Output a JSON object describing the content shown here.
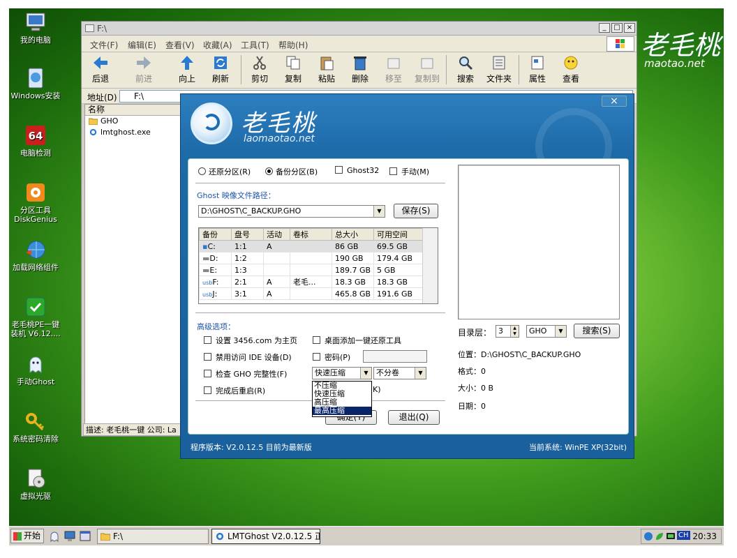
{
  "desktop": {
    "brand": {
      "name": "老毛桃",
      "url": "maotao.net"
    },
    "icons": [
      {
        "label": "我的电脑",
        "icon": "computer-icon"
      },
      {
        "label": "Windows安装",
        "icon": "windows-install-icon"
      },
      {
        "label": "电脑检测",
        "icon": "cpu-64-icon"
      },
      {
        "label": "分区工具\nDiskGenius",
        "icon": "diskgenius-icon"
      },
      {
        "label": "加载网络组件",
        "icon": "network-globe-icon"
      },
      {
        "label": "老毛桃PE一键\n装机 V6.12....",
        "icon": "laomaotao-installer-icon"
      },
      {
        "label": "手动Ghost",
        "icon": "ghost-icon"
      },
      {
        "label": "系统密码清除",
        "icon": "key-icon"
      },
      {
        "label": "虚拟光驱",
        "icon": "virtual-cdrom-icon"
      }
    ]
  },
  "explorer": {
    "title": "F:\\",
    "menu": [
      "文件(F)",
      "编辑(E)",
      "查看(V)",
      "收藏(A)",
      "工具(T)",
      "帮助(H)"
    ],
    "toolbar": [
      {
        "label": "后退",
        "icon": "back-arrow-icon",
        "enabled": true
      },
      {
        "label": "前进",
        "icon": "forward-arrow-icon",
        "enabled": false
      },
      {
        "label": "向上",
        "icon": "up-arrow-icon",
        "enabled": true
      },
      {
        "label": "刷新",
        "icon": "refresh-icon",
        "enabled": true
      },
      {
        "label": "剪切",
        "icon": "scissors-icon",
        "enabled": true
      },
      {
        "label": "复制",
        "icon": "copy-icon",
        "enabled": true
      },
      {
        "label": "粘贴",
        "icon": "paste-icon",
        "enabled": true
      },
      {
        "label": "删除",
        "icon": "delete-icon",
        "enabled": true
      },
      {
        "label": "移至",
        "icon": "move-to-icon",
        "enabled": false
      },
      {
        "label": "复制到",
        "icon": "copy-to-icon",
        "enabled": false
      },
      {
        "label": "搜索",
        "icon": "search-icon",
        "enabled": true
      },
      {
        "label": "文件夹",
        "icon": "folder-tree-icon",
        "enabled": true
      },
      {
        "label": "属性",
        "icon": "properties-icon",
        "enabled": true
      },
      {
        "label": "查看",
        "icon": "view-icon",
        "enabled": true
      }
    ],
    "address_label": "地址(D)",
    "address_value": "F:\\",
    "column_header": "名称",
    "files": [
      {
        "name": "GHO",
        "icon": "folder-icon"
      },
      {
        "name": "lmtghost.exe",
        "icon": "ghost-exe-icon"
      }
    ],
    "status": "描述: 老毛桃一键 公司: La"
  },
  "dialog": {
    "brand_name": "老毛桃",
    "brand_url": "laomaotao.net",
    "close": "×",
    "modes": [
      {
        "label": "还原分区(R)",
        "type": "radio",
        "checked": false
      },
      {
        "label": "备份分区(B)",
        "type": "radio",
        "checked": true
      },
      {
        "label": "Ghost32",
        "type": "checkbox",
        "checked": false
      },
      {
        "label": "手动(M)",
        "type": "checkbox",
        "checked": false
      }
    ],
    "path_label": "Ghost 映像文件路径：",
    "path_value": "D:\\GHOST\\C_BACKUP.GHO",
    "save_label": "保存(S)",
    "table": {
      "headers": [
        "备份",
        "盘号",
        "活动",
        "卷标",
        "总大小",
        "可用空间"
      ],
      "rows": [
        [
          "C:",
          "1:1",
          "A",
          "",
          "86 GB",
          "69.5 GB"
        ],
        [
          "D:",
          "1:2",
          "",
          "",
          "190 GB",
          "179.4 GB"
        ],
        [
          "E:",
          "1:3",
          "",
          "",
          "189.7 GB",
          "5 GB"
        ],
        [
          "F:",
          "2:1",
          "A",
          "老毛...",
          "18.3 GB",
          "18.3 GB"
        ],
        [
          "J:",
          "3:1",
          "A",
          "",
          "465.8 GB",
          "191.6 GB"
        ]
      ]
    },
    "advanced_label": "高级选项：",
    "options": {
      "homepage": "设置 3456.com 为主页",
      "desktop_restore": "桌面添加一键还原工具",
      "disable_ide": "禁用访问 IDE 设备(D)",
      "password": "密码(P)",
      "check_gho": "检查 GHO 完整性(F)",
      "reboot": "完成后重启(R)"
    },
    "compression_selected": "快速压缩",
    "compression_options": [
      "不压缩",
      "快速压缩",
      "高压缩",
      "最高压缩"
    ],
    "compression_highlighted": "最高压缩",
    "split_selected": "不分卷",
    "partial_letter": "K)",
    "ok_label": "确定(Y)",
    "exit_label": "退出(Q)",
    "dir_level_label": "目录层：",
    "dir_level_value": "3",
    "ext_value": "GHO",
    "search_label": "搜索(S)",
    "info": {
      "location": "位置：D:\\GHOST\\C_BACKUP.GHO",
      "format": "格式：0",
      "size": "大小：0 B",
      "date": "日期：0"
    },
    "version": "程序版本: V2.0.12.5   目前为最新版",
    "system": "当前系统: WinPE XP(32bit)"
  },
  "taskbar": {
    "start_label": "开始",
    "tasks": [
      {
        "label": "F:\\",
        "icon": "folder-icon",
        "active": false
      },
      {
        "label": "LMTGhost V2.0.12.5 正...",
        "icon": "ghost-exe-icon",
        "active": true
      }
    ],
    "tray_ime": "CH",
    "clock": "20:33"
  },
  "colors": {
    "dialog_blue": "#1d6aa8",
    "selection": "#0a246a",
    "desktop_green": "#4fa31f"
  }
}
